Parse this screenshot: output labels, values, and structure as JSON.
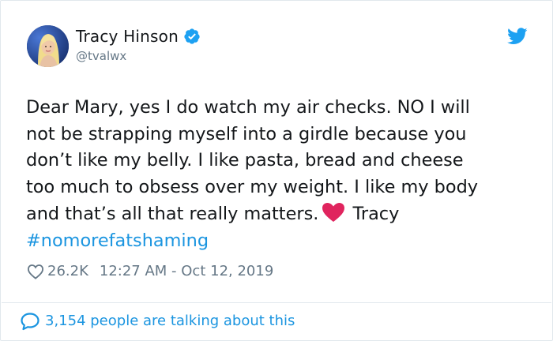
{
  "tweet": {
    "author": {
      "display_name": "Tracy Hinson",
      "handle": "@tvalwx",
      "verified": true
    },
    "text_line_1": "Dear Mary, yes I do watch my air checks. NO I will",
    "text_line_2": "not be strapping myself into a girdle because you",
    "text_line_3": "don’t like my belly. I like pasta, bread and cheese",
    "text_line_4": "too much to obsess over my weight. I like my body",
    "text_line_5a": "and that’s all that really matters.",
    "text_line_5b": "Tracy",
    "hashtag": "#nomorefatshaming",
    "likes": "26.2K",
    "timestamp": "12:27 AM - Oct 12, 2019",
    "conversation": "3,154 people are talking about this"
  },
  "icons": {
    "verified": "verified-badge-icon",
    "brand": "twitter-bird-icon",
    "heart_emoji": "red-heart-emoji",
    "like": "heart-outline-icon",
    "reply": "speech-bubble-icon"
  },
  "colors": {
    "accent": "#1b95e0",
    "verified": "#1da1f2",
    "muted": "#657786",
    "text": "#14171a",
    "heart_emoji": "#e0245e"
  }
}
